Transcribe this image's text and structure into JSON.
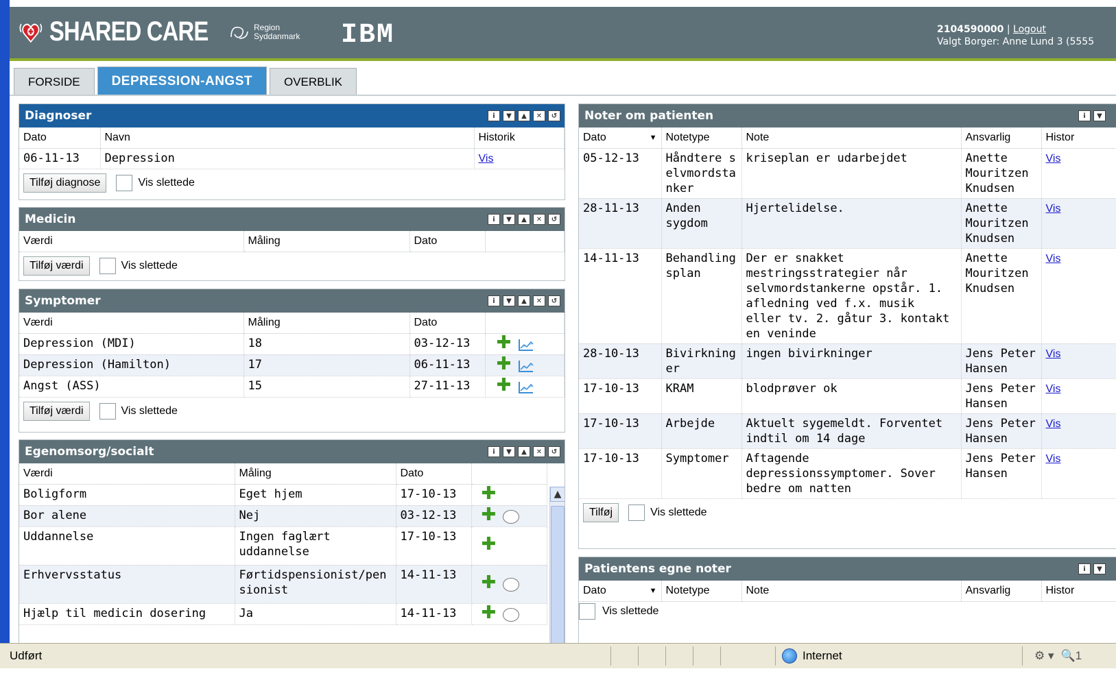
{
  "header": {
    "brand": "SHARED CARE",
    "region_line1": "Region",
    "region_line2": "Syddanmark",
    "partner_logo": "IBM",
    "user_id": "2104590000",
    "logout": "Logout",
    "selected_citizen": "Valgt Borger: Anne Lund 3 (5555"
  },
  "tabs": [
    {
      "label": "FORSIDE",
      "active": false
    },
    {
      "label": "DEPRESSION-ANGST",
      "active": true
    },
    {
      "label": "OVERBLIK",
      "active": false
    }
  ],
  "diagnoser": {
    "title": "Diagnoser",
    "columns": [
      "Dato",
      "Navn",
      "Historik"
    ],
    "rows": [
      {
        "dato": "06-11-13",
        "navn": "Depression",
        "historik": "Vis"
      }
    ],
    "add_button": "Tilføj diagnose",
    "show_deleted": "Vis slettede"
  },
  "medicin": {
    "title": "Medicin",
    "columns": [
      "Værdi",
      "Måling",
      "Dato"
    ],
    "add_button": "Tilføj værdi",
    "show_deleted": "Vis slettede"
  },
  "symptomer": {
    "title": "Symptomer",
    "columns": [
      "Værdi",
      "Måling",
      "Dato"
    ],
    "rows": [
      {
        "vaerdi": "Depression (MDI)",
        "maaling": "18",
        "dato": "03-12-13"
      },
      {
        "vaerdi": "Depression (Hamilton)",
        "maaling": "17",
        "dato": "06-11-13"
      },
      {
        "vaerdi": "Angst (ASS)",
        "maaling": "15",
        "dato": "27-11-13"
      }
    ],
    "add_button": "Tilføj værdi",
    "show_deleted": "Vis slettede"
  },
  "egenomsorg": {
    "title": "Egenomsorg/socialt",
    "columns": [
      "Værdi",
      "Måling",
      "Dato"
    ],
    "rows": [
      {
        "vaerdi": "Boligform",
        "maaling": "Eget hjem",
        "dato": "17-10-13"
      },
      {
        "vaerdi": "Bor alene",
        "maaling": "Nej",
        "dato": "03-12-13"
      },
      {
        "vaerdi": "Uddannelse",
        "maaling": "Ingen faglært uddannelse",
        "dato": "17-10-13"
      },
      {
        "vaerdi": "Erhvervsstatus",
        "maaling": "Førtidspensionist/pensionist",
        "dato": "14-11-13"
      },
      {
        "vaerdi": "Hjælp til medicin dosering",
        "maaling": "Ja",
        "dato": "14-11-13"
      }
    ]
  },
  "noter": {
    "title": "Noter om patienten",
    "columns": [
      "Dato",
      "Notetype",
      "Note",
      "Ansvarlig",
      "Histor"
    ],
    "rows": [
      {
        "dato": "05-12-13",
        "type": "Håndtere selvmordstanker",
        "note": "kriseplan er udarbejdet",
        "ansvarlig": "Anette Mouritzen Knudsen",
        "historik": "Vis"
      },
      {
        "dato": "28-11-13",
        "type": "Anden sygdom",
        "note": "Hjertelidelse.",
        "ansvarlig": "Anette Mouritzen Knudsen",
        "historik": "Vis"
      },
      {
        "dato": "14-11-13",
        "type": "Behandlingsplan",
        "note": "Der er snakket mestringsstrategier når selvmordstankerne opstår. 1. afledning ved f.x. musik eller tv. 2. gåtur 3. kontakt en veninde",
        "ansvarlig": "Anette Mouritzen Knudsen",
        "historik": "Vis"
      },
      {
        "dato": "28-10-13",
        "type": "Bivirkninger",
        "note": "ingen bivirkninger",
        "ansvarlig": "Jens Peter Hansen",
        "historik": "Vis"
      },
      {
        "dato": "17-10-13",
        "type": "KRAM",
        "note": "blodprøver ok",
        "ansvarlig": "Jens Peter Hansen",
        "historik": "Vis"
      },
      {
        "dato": "17-10-13",
        "type": "Arbejde",
        "note": "Aktuelt sygemeldt. Forventet indtil om 14 dage",
        "ansvarlig": "Jens Peter Hansen",
        "historik": "Vis"
      },
      {
        "dato": "17-10-13",
        "type": "Symptomer",
        "note": "Aftagende depressionssymptomer. Sover bedre om natten",
        "ansvarlig": "Jens Peter Hansen",
        "historik": "Vis"
      }
    ],
    "add_button": "Tilføj",
    "show_deleted": "Vis slettede"
  },
  "egne_noter": {
    "title": "Patientens egne noter",
    "columns": [
      "Dato",
      "Notetype",
      "Note",
      "Ansvarlig",
      "Histor"
    ],
    "show_deleted": "Vis slettede"
  },
  "statusbar": {
    "status": "Udført",
    "zone": "Internet",
    "zoom": "1"
  },
  "colors": {
    "header_bg": "#5e7179",
    "active_tab": "#3d8fcd",
    "blue_panel_title": "#1c5f9e",
    "accent_green": "#8fae2c"
  }
}
